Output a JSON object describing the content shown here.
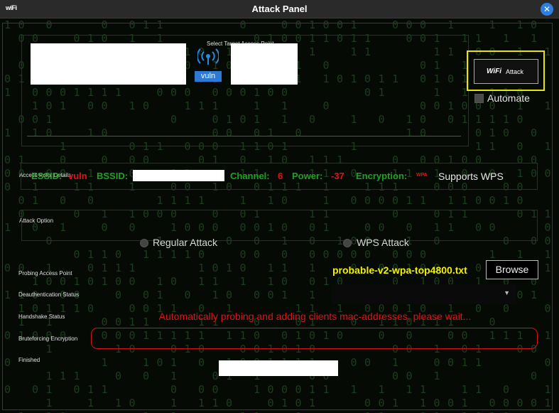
{
  "window": {
    "title": "Attack Panel",
    "app_icon": "wifi-icon",
    "close_icon": "close-icon",
    "accent": "#2f7fe0"
  },
  "target": {
    "label": "Select Target Access Point",
    "tag": "vuln",
    "icon": "antenna-icon"
  },
  "attack": {
    "button_label": "Attack",
    "logo_text": "WiFi",
    "automate_label": "Automate",
    "highlight": "#e6e600"
  },
  "details": {
    "label": "Access Point Details",
    "essid_label": "ESSID:",
    "essid_value": "vuln",
    "bssid_label": "BSSID:",
    "channel_label": "Channel:",
    "channel_value": "6",
    "power_label": "Power:",
    "power_value": "-37",
    "encryption_label": "Encryption:",
    "encryption_value": "WPA",
    "supports": "Supports WPS"
  },
  "option": {
    "label": "Attack Option",
    "regular": "Regular Attack",
    "wps": "WPS  Attack"
  },
  "status": {
    "probing": "Probing Access Point",
    "deauth": "Deauthentication Status",
    "handshake": "Handshake Status",
    "bruteforce": "Bruteforcing Encryption",
    "finished": "Finished",
    "message": "Automatically probing and adding clients mac-addresses, please wait..."
  },
  "wordlist": {
    "file": "probable-v2-wpa-top4800.txt",
    "browse_label": "Browse"
  },
  "colors": {
    "label_green": "#21a121",
    "value_red": "#e01414",
    "wordlist_yellow": "#f2f200"
  }
}
